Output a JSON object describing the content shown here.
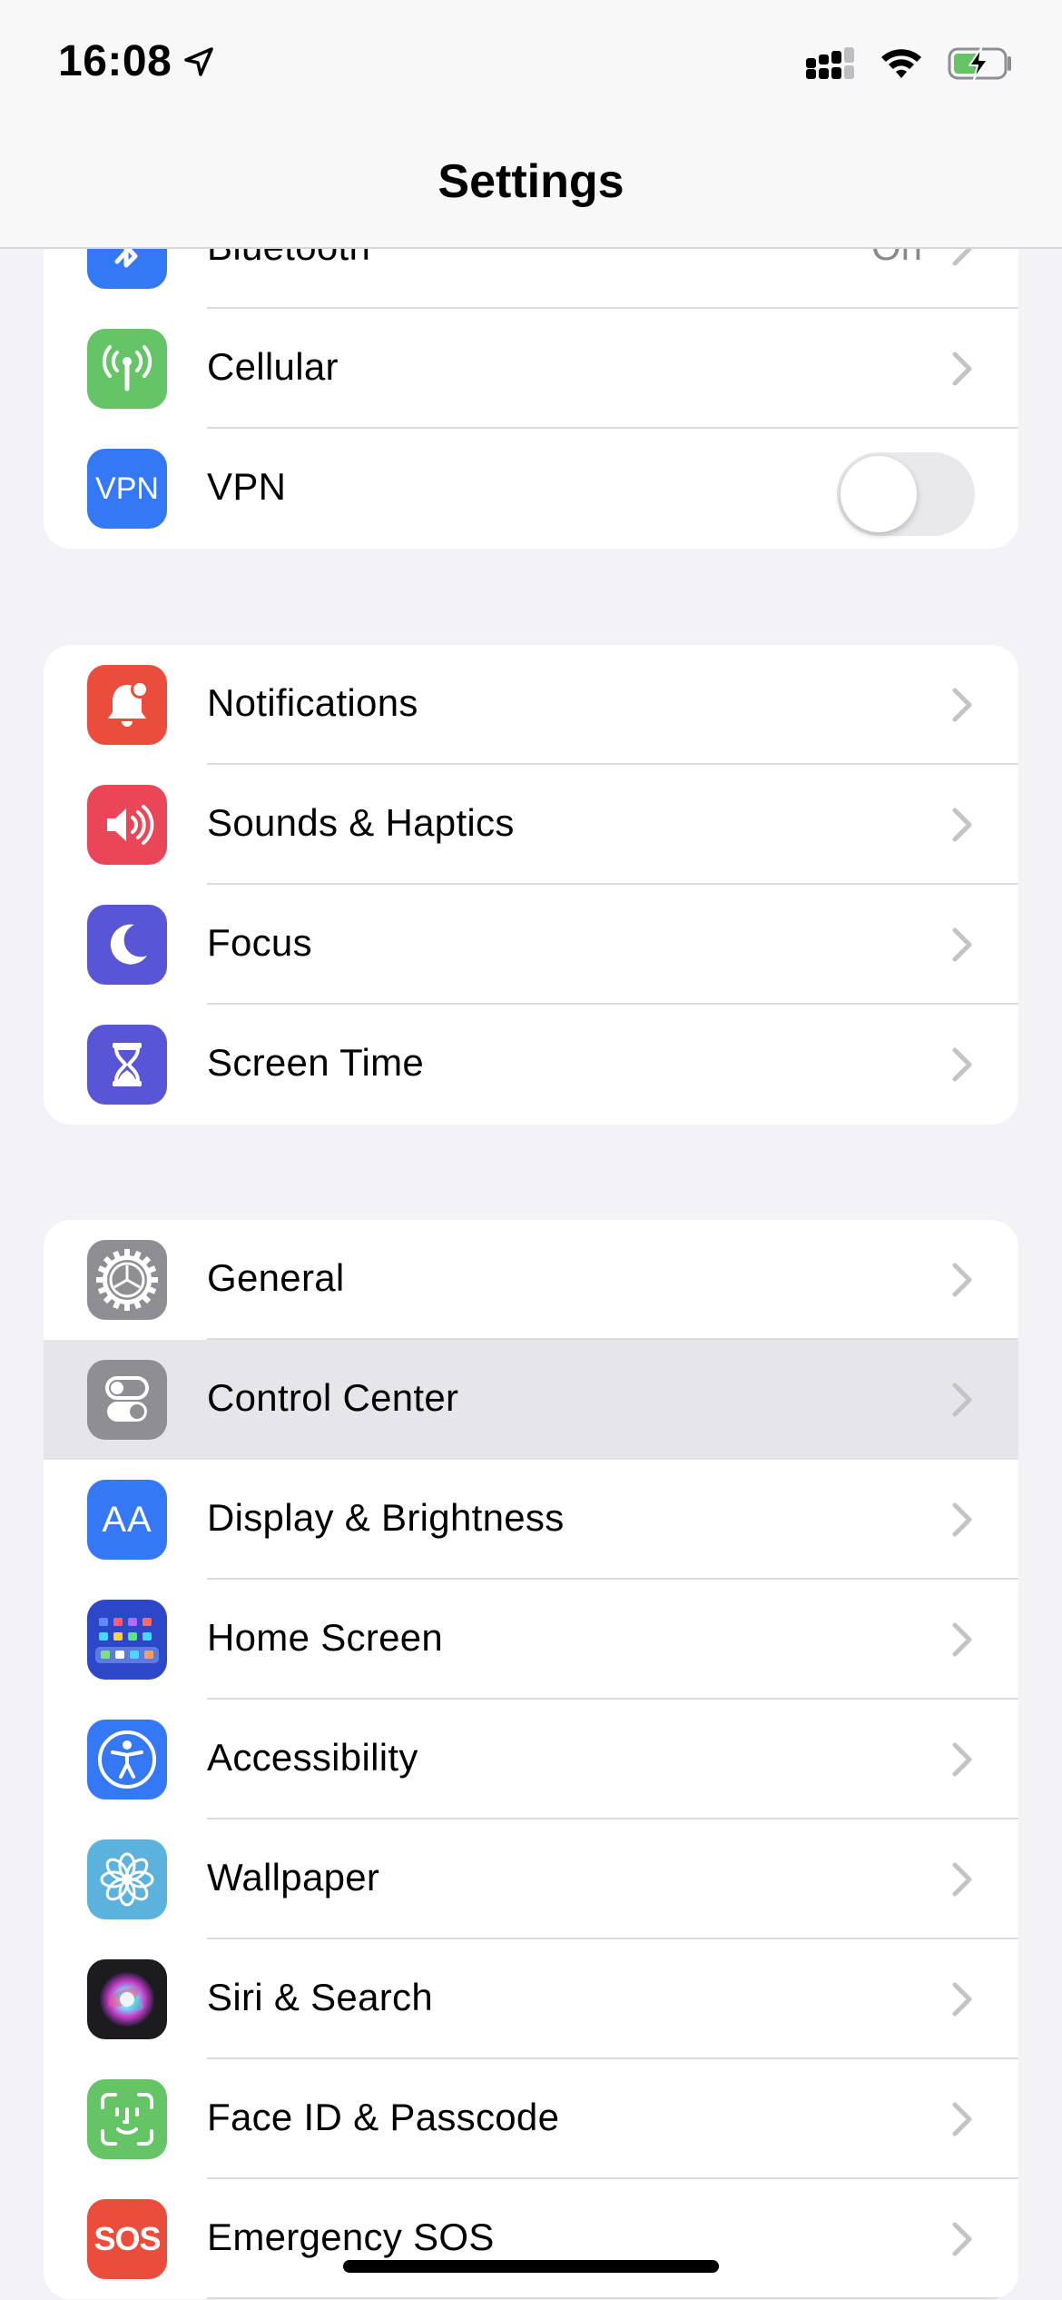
{
  "status_bar": {
    "time": "16:08"
  },
  "nav": {
    "title": "Settings"
  },
  "groups": [
    {
      "rows": [
        {
          "label": "Bluetooth",
          "value": "On",
          "icon": "bluetooth-icon",
          "color": "#3478f6"
        },
        {
          "label": "Cellular",
          "icon": "antenna-icon",
          "color": "#65c466"
        },
        {
          "label": "VPN",
          "icon": "vpn-icon",
          "color": "#3478f6",
          "toggle": false
        }
      ]
    },
    {
      "rows": [
        {
          "label": "Notifications",
          "icon": "bell-icon",
          "color": "#eb4d3d"
        },
        {
          "label": "Sounds & Haptics",
          "icon": "speaker-icon",
          "color": "#eb4658"
        },
        {
          "label": "Focus",
          "icon": "moon-icon",
          "color": "#5856d6"
        },
        {
          "label": "Screen Time",
          "icon": "hourglass-icon",
          "color": "#5856d6"
        }
      ]
    },
    {
      "rows": [
        {
          "label": "General",
          "icon": "gear-icon",
          "color": "#8e8e93"
        },
        {
          "label": "Control Center",
          "icon": "switches-icon",
          "color": "#8e8e93",
          "highlighted": true
        },
        {
          "label": "Display & Brightness",
          "icon": "text-size-icon",
          "color": "#3478f6"
        },
        {
          "label": "Home Screen",
          "icon": "app-grid-icon",
          "color": "#2c48c8"
        },
        {
          "label": "Accessibility",
          "icon": "accessibility-icon",
          "color": "#3478f6"
        },
        {
          "label": "Wallpaper",
          "icon": "flower-icon",
          "color": "#5ab2dd"
        },
        {
          "label": "Siri & Search",
          "icon": "siri-icon",
          "color": "#1c1c1e"
        },
        {
          "label": "Face ID & Passcode",
          "icon": "face-id-icon",
          "color": "#65c466"
        },
        {
          "label": "Emergency SOS",
          "icon": "sos-icon",
          "color": "#eb4d3d",
          "icon_text": "SOS"
        }
      ]
    }
  ],
  "vpn_icon_text": "VPN",
  "text_size_icon_text": "AA"
}
